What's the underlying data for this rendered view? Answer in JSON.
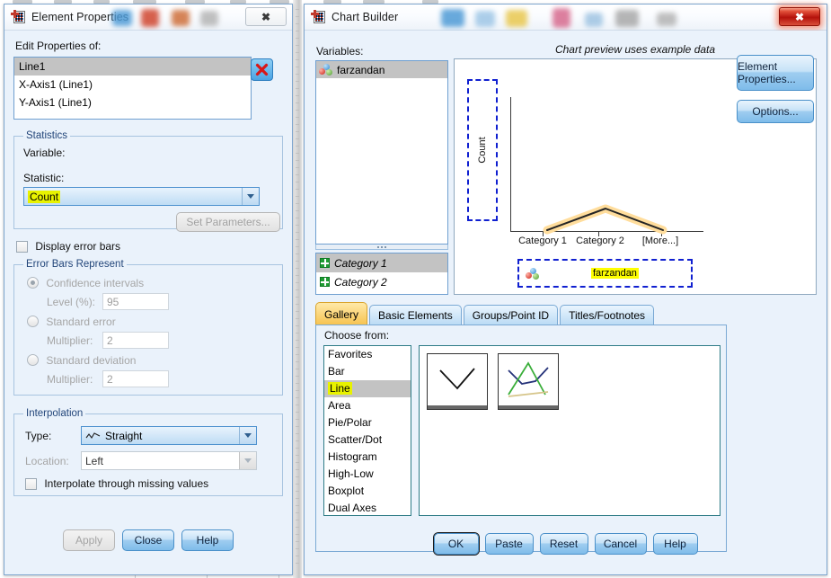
{
  "background": {
    "toolbar_icons": [
      "grid-icon",
      "chart-icon",
      "table-icon",
      "person-icon",
      "chart2-icon",
      "blob-icon",
      "blob2-icon"
    ]
  },
  "element_properties": {
    "title": "Element Properties",
    "close_label": "✖",
    "edit_properties_label": "Edit Properties of:",
    "items": [
      {
        "label": "Line1",
        "selected": true
      },
      {
        "label": "X-Axis1 (Line1)",
        "selected": false
      },
      {
        "label": "Y-Axis1 (Line1)",
        "selected": false
      }
    ],
    "remove_button_label": "✕",
    "statistics": {
      "legend": "Statistics",
      "variable_label": "Variable:",
      "statistic_label": "Statistic:",
      "statistic_value": "Count",
      "set_parameters_label": "Set Parameters..."
    },
    "display_error_bars_label": "Display error bars",
    "display_error_bars_checked": false,
    "error_bars": {
      "legend": "Error Bars Represent",
      "confidence_intervals_label": "Confidence intervals",
      "confidence_selected": true,
      "level_label": "Level (%):",
      "level_value": "95",
      "standard_error_label": "Standard error",
      "standard_error_multiplier_label": "Multiplier:",
      "standard_error_multiplier_value": "2",
      "standard_deviation_label": "Standard deviation",
      "standard_deviation_multiplier_label": "Multiplier:",
      "standard_deviation_multiplier_value": "2"
    },
    "interpolation": {
      "legend": "Interpolation",
      "type_label": "Type:",
      "type_value": "Straight",
      "location_label": "Location:",
      "location_value": "Left",
      "interpolate_missing_label": "Interpolate through missing values",
      "interpolate_missing_checked": false
    },
    "buttons": {
      "apply": "Apply",
      "close": "Close",
      "help": "Help"
    }
  },
  "chart_builder": {
    "title": "Chart Builder",
    "close_label": "✖",
    "variables_label": "Variables:",
    "variables": [
      {
        "label": "farzandan",
        "icon": "nominal-icon",
        "selected": true
      }
    ],
    "categories": [
      {
        "label": "Category 1",
        "icon": "grid-icon",
        "selected": true
      },
      {
        "label": "Category 2",
        "icon": "grid-icon",
        "selected": false
      }
    ],
    "preview_caption": "Chart preview uses example data",
    "tabs": [
      {
        "label": "Gallery",
        "active": true
      },
      {
        "label": "Basic Elements",
        "active": false
      },
      {
        "label": "Groups/Point ID",
        "active": false
      },
      {
        "label": "Titles/Footnotes",
        "active": false
      }
    ],
    "choose_from_label": "Choose from:",
    "gallery_items": [
      {
        "label": "Favorites",
        "selected": false
      },
      {
        "label": "Bar",
        "selected": false
      },
      {
        "label": "Line",
        "selected": true
      },
      {
        "label": "Area",
        "selected": false
      },
      {
        "label": "Pie/Polar",
        "selected": false
      },
      {
        "label": "Scatter/Dot",
        "selected": false
      },
      {
        "label": "Histogram",
        "selected": false
      },
      {
        "label": "High-Low",
        "selected": false
      },
      {
        "label": "Boxplot",
        "selected": false
      },
      {
        "label": "Dual Axes",
        "selected": false
      }
    ],
    "thumbnails": [
      {
        "name": "simple-line-thumbnail"
      },
      {
        "name": "multiple-line-thumbnail"
      }
    ],
    "side_buttons": {
      "element_properties": "Element Properties...",
      "options": "Options..."
    },
    "buttons": {
      "ok": "OK",
      "paste": "Paste",
      "reset": "Reset",
      "cancel": "Cancel",
      "help": "Help"
    }
  },
  "chart_data": {
    "type": "line",
    "title": "",
    "xlabel": "",
    "ylabel": "Count",
    "categories": [
      "Category 1",
      "Category 2",
      "[More...]"
    ],
    "values": [
      1,
      2,
      1
    ],
    "legend_field": "farzandan",
    "grid": false,
    "series": [
      {
        "name": "Count",
        "values": [
          1,
          2,
          1
        ]
      }
    ],
    "annotations": [
      "Chart preview uses example data"
    ]
  },
  "colors": {
    "accent": "#2f7fc0",
    "highlight_yellow": "#ffff00",
    "highlight_olive": "#e8f200",
    "tab_active": "#f6c24e",
    "dropzone_blue": "#1020d0",
    "selection_glow": "#ffe2a0",
    "close_red": "#b4120b"
  }
}
